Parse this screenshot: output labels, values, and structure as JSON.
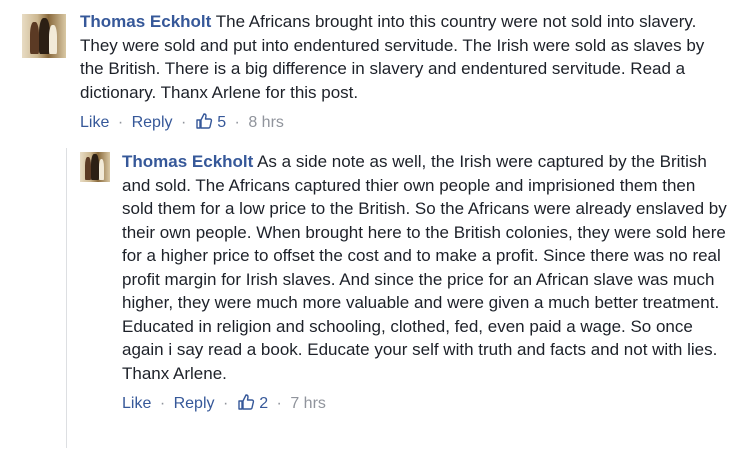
{
  "comments": [
    {
      "author": "Thomas Eckholt",
      "text": " The Africans brought into this country were not sold into slavery. They were sold and put into endentured servitude. The Irish were sold as slaves by the British. There is a big difference in slavery and endentured servitude. Read a dictionary. Thanx Arlene for this post.",
      "like_label": "Like",
      "reply_label": "Reply",
      "like_count": "5",
      "time": "8 hrs",
      "sep": "·"
    },
    {
      "author": "Thomas Eckholt",
      "text": " As a side note as well, the Irish were captured by the British and sold. The Africans captured thier own people and imprisioned them then sold them for a low price to the British. So the Africans were already enslaved by their own people. When brought here to the British colonies, they were sold here for a higher price to offset the cost and to make a profit. Since there was no real profit margin for Irish slaves. And since the price for an African slave was much higher, they were much more valuable and were given a much better treatment. Educated in religion and schooling, clothed, fed, even paid a wage. So once again i say read a book. Educate your self with truth and facts and not with lies. Thanx Arlene.",
      "like_label": "Like",
      "reply_label": "Reply",
      "like_count": "2",
      "time": "7 hrs",
      "sep": "·"
    }
  ],
  "colors": {
    "link": "#365899",
    "meta": "#90949c",
    "text": "#1d2129",
    "thread_line": "#dddfe2"
  },
  "icons": {
    "avatar": "profile-photo",
    "like": "thumbs-up-icon"
  }
}
